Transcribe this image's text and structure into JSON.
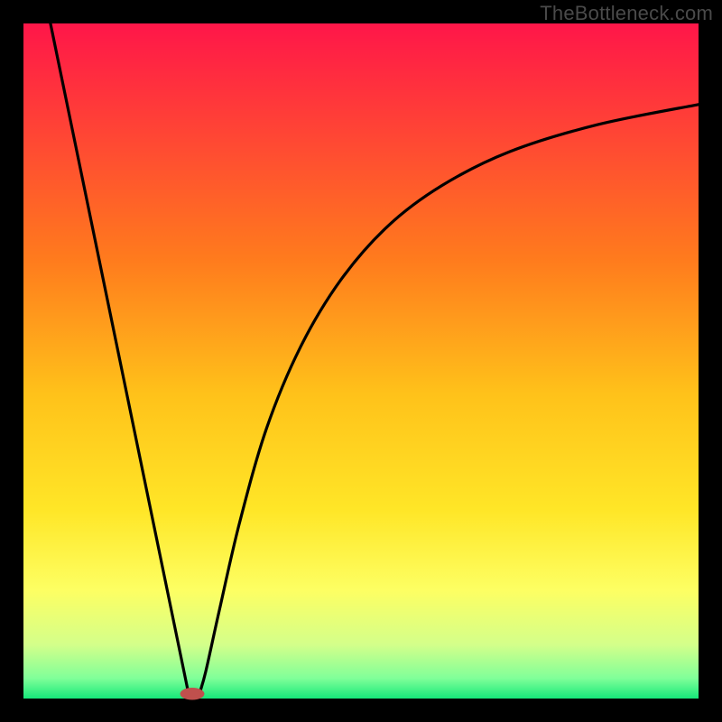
{
  "watermark": "TheBottleneck.com",
  "chart_data": {
    "type": "line",
    "title": "",
    "xlabel": "",
    "ylabel": "",
    "xlim": [
      0,
      100
    ],
    "ylim": [
      0,
      100
    ],
    "grid": false,
    "legend": false,
    "gradient_stops": [
      {
        "offset": 0,
        "color": "#ff1649"
      },
      {
        "offset": 35,
        "color": "#ff7b1d"
      },
      {
        "offset": 55,
        "color": "#ffc21a"
      },
      {
        "offset": 72,
        "color": "#ffe627"
      },
      {
        "offset": 84,
        "color": "#fdff63"
      },
      {
        "offset": 92,
        "color": "#d4ff8a"
      },
      {
        "offset": 97,
        "color": "#80ff99"
      },
      {
        "offset": 100,
        "color": "#16e87a"
      }
    ],
    "series": [
      {
        "name": "left-descent",
        "x": [
          4.0,
          24.5
        ],
        "y": [
          100.0,
          0.5
        ]
      },
      {
        "name": "right-ascent",
        "x": [
          26.0,
          27.0,
          29.0,
          32.0,
          36.0,
          41.0,
          47.0,
          54.0,
          62.0,
          72.0,
          85.0,
          100.0
        ],
        "y": [
          0.5,
          4.0,
          13.0,
          26.0,
          40.0,
          52.0,
          62.0,
          70.0,
          76.0,
          81.0,
          85.0,
          88.0
        ]
      }
    ],
    "marker": {
      "x": 25.0,
      "y": 0.7,
      "rx": 1.8,
      "ry": 0.9,
      "color": "#c0504d"
    }
  }
}
